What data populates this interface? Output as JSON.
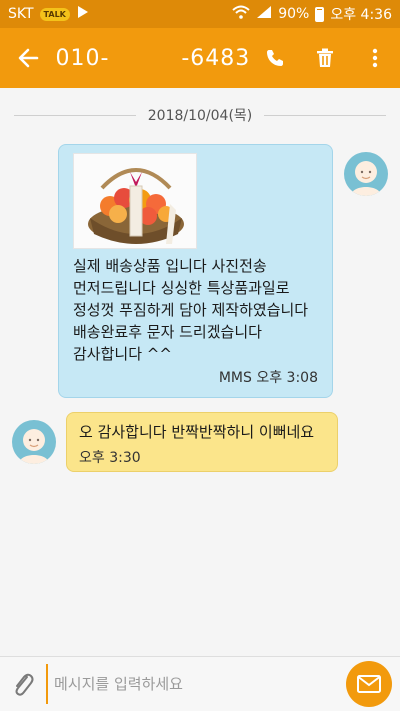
{
  "status_bar": {
    "carrier": "SKT",
    "talk_badge": "TALK",
    "battery": "90%",
    "time": "오후 4:36",
    "icons": [
      "talk-icon",
      "play-store-icon",
      "wifi-icon",
      "signal-icon",
      "battery-icon"
    ]
  },
  "app_bar": {
    "title": "010-         -6483",
    "icons": [
      "back-arrow-icon",
      "phone-icon",
      "trash-icon",
      "overflow-menu-icon"
    ]
  },
  "conversation": {
    "date": "2018/10/04(목)",
    "messages": [
      {
        "direction": "sent",
        "lines": [
          "실제 배송상품 입니다 사진전송",
          "먼저드립니다 싱싱한 특상품과일로",
          "정성껏 푸짐하게 담아 제작하였습니다",
          "배송완료후 문자 드리겠습니다",
          "감사합니다 ^^"
        ],
        "meta": "MMS 오후 3:08"
      },
      {
        "direction": "received",
        "text": "오 감사합니다 반짝반짝하니 이뻐네요",
        "meta": "오후 3:30"
      }
    ]
  },
  "input_bar": {
    "placeholder": "메시지를 입력하세요",
    "value": ""
  },
  "colors": {
    "status_bar": "#de8a08",
    "app_bar": "#f29a0d",
    "sent_bubble": "#c6e8f5",
    "received_bubble": "#fbe58b",
    "avatar": "#79c0d3",
    "send_button": "#f29a0d"
  }
}
